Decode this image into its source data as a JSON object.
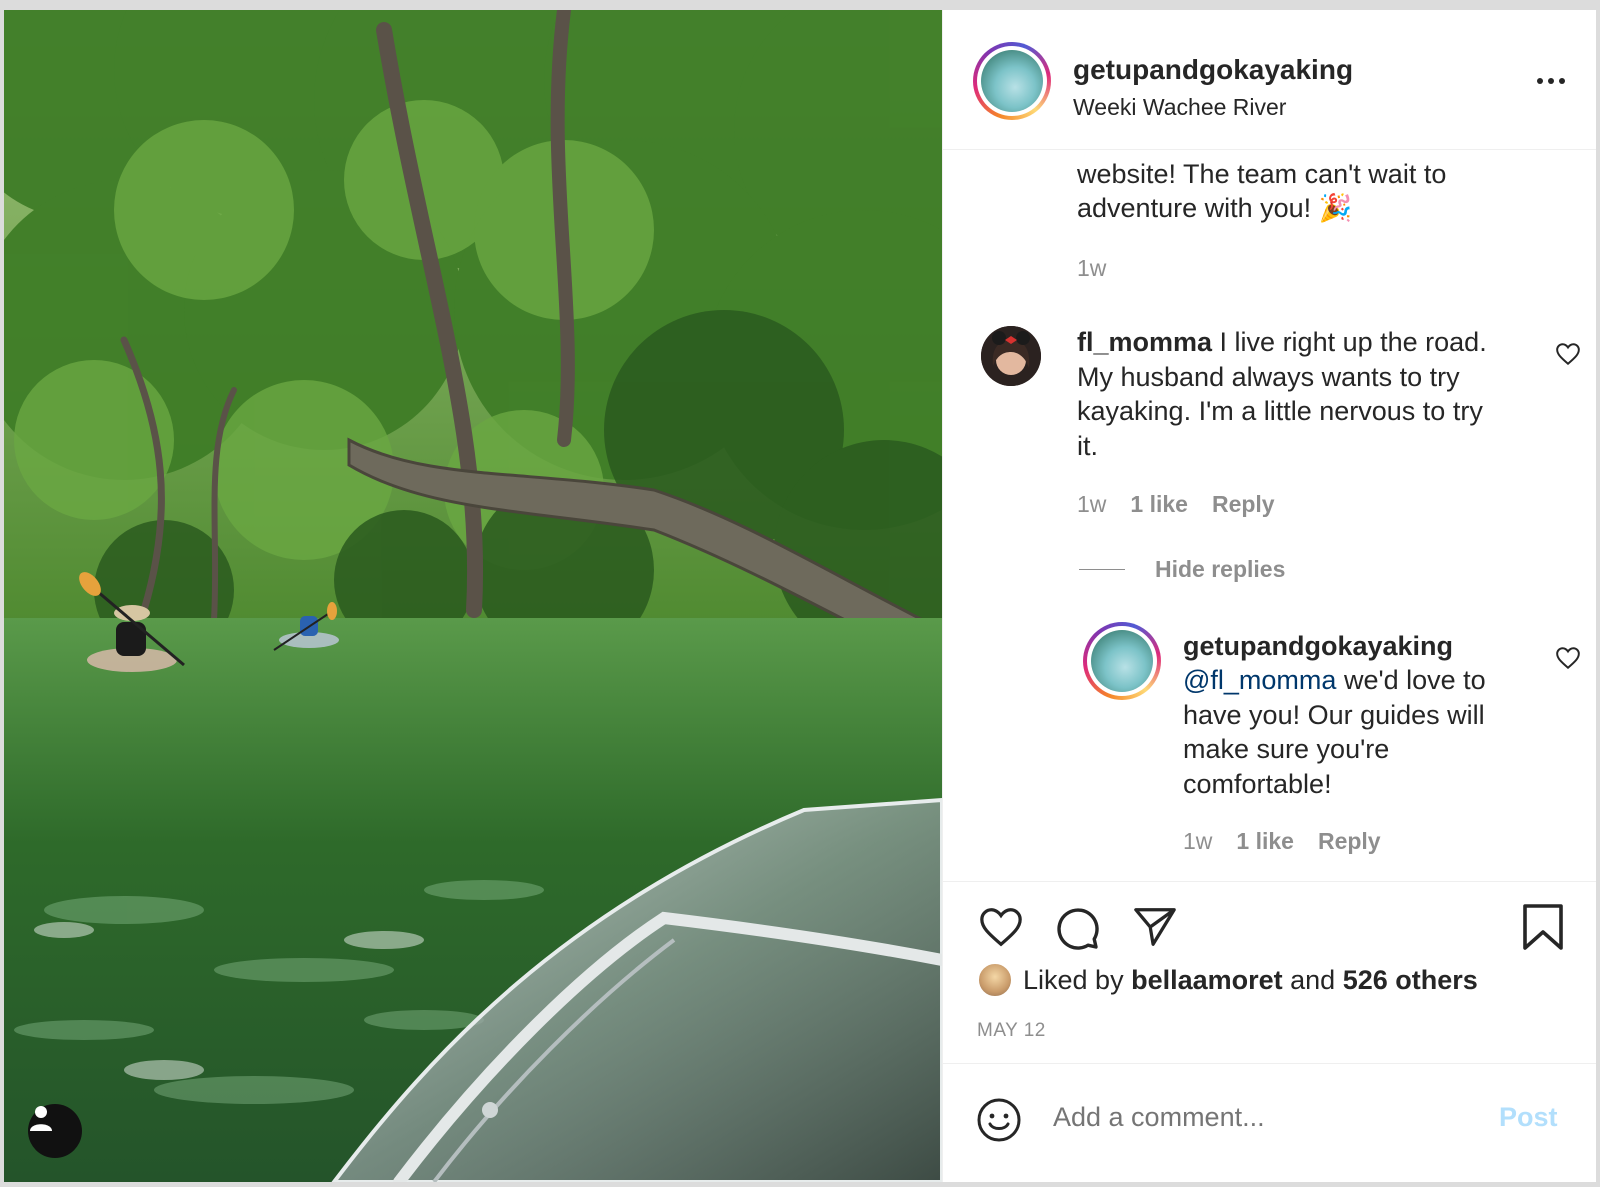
{
  "post": {
    "author": "getupandgokayaking",
    "location": "Weeki Wachee River",
    "more_icon": "more-options-icon"
  },
  "comments": {
    "prev_comment": {
      "line1": "website! The team can't wait to",
      "line2": "adventure with you! 🎉",
      "time": "1w"
    },
    "comment1": {
      "username": "fl_momma",
      "text_line1": " I live right up the road.",
      "text_line2": "My husband always wants to try",
      "text_line3": "kayaking. I'm a little nervous to try",
      "text_line4": "it.",
      "time": "1w",
      "likes": "1 like",
      "reply": "Reply"
    },
    "hide_replies": "Hide replies",
    "reply1": {
      "username": "getupandgokayaking",
      "mention": "@fl_momma",
      "text_line1": " we'd love to",
      "text_line2": "have you! Our guides will",
      "text_line3": "make sure you're",
      "text_line4": "comfortable!",
      "time": "1w",
      "likes": "1 like",
      "reply": "Reply"
    }
  },
  "actions": {
    "liked_prefix": "Liked by ",
    "liked_user": "bellaamoret",
    "liked_and": " and ",
    "liked_others": "526 others",
    "date": "MAY 12"
  },
  "add_comment": {
    "placeholder": "Add a comment...",
    "post_label": "Post"
  },
  "colors": {
    "link": "#00376b",
    "post_disabled": "#b2dffc",
    "muted": "#8e8e8e"
  }
}
